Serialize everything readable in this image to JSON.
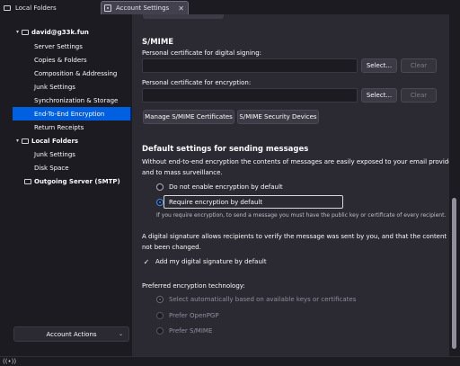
{
  "tabs": [
    {
      "label": "Local Folders"
    },
    {
      "label": "Account Settings"
    }
  ],
  "sidebar": {
    "account": "david@g33k.fun",
    "items": [
      {
        "label": "Server Settings"
      },
      {
        "label": "Copies & Folders"
      },
      {
        "label": "Composition & Addressing"
      },
      {
        "label": "Junk Settings"
      },
      {
        "label": "Synchronization & Storage"
      },
      {
        "label": "End-To-End Encryption"
      },
      {
        "label": "Return Receipts"
      }
    ],
    "local_folders": "Local Folders",
    "local_items": [
      {
        "label": "Junk Settings"
      },
      {
        "label": "Disk Space"
      }
    ],
    "outgoing": "Outgoing Server (SMTP)",
    "account_actions": "Account Actions"
  },
  "smime": {
    "heading": "S/MIME",
    "signing_label": "Personal certificate for digital signing:",
    "encryption_label": "Personal certificate for encryption:",
    "select_label": "Select...",
    "clear_label": "Clear",
    "manage_label": "Manage S/MIME Certificates",
    "devices_label": "S/MIME Security Devices"
  },
  "defaults": {
    "heading": "Default settings for sending messages",
    "desc_line1": "Without end-to-end encryption the contents of messages are easily exposed to your email provider",
    "desc_line2": "and to mass surveillance.",
    "opt_no_encrypt": "Do not enable encryption by default",
    "opt_require": "Require encryption by default",
    "require_note": "If you require encryption, to send a message you must have the public key or certificate of every recipient.",
    "sig_line1": "A digital signature allows recipients to verify the message was sent by you, and that the content has",
    "sig_line2": "not been changed.",
    "add_signature": "Add my digital signature by default",
    "pref_tech": "Preferred encryption technology:",
    "tech_auto": "Select automatically based on available keys or certificates",
    "tech_pgp": "Prefer OpenPGP",
    "tech_smime": "Prefer S/MIME"
  },
  "colors": {
    "accent": "#0060df",
    "radio_accent": "#3b8ef0"
  }
}
